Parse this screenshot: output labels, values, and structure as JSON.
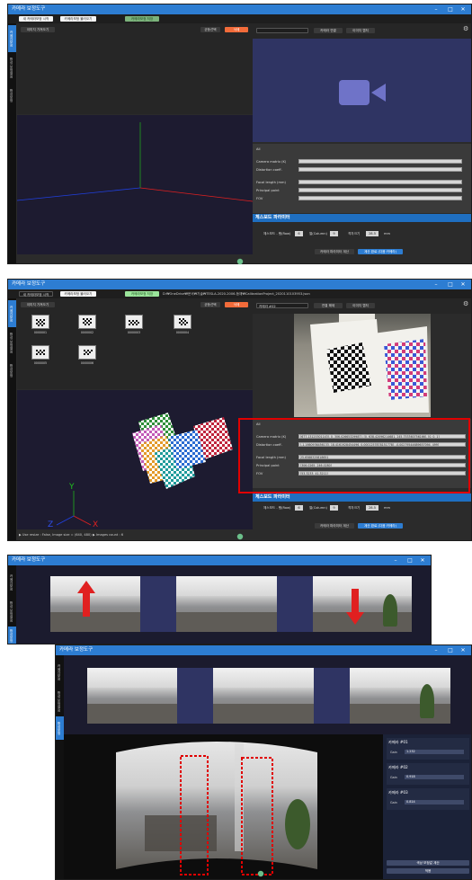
{
  "app": {
    "title": "카메라 보정도구"
  },
  "menu": {
    "new_calibration": "새 카메라보정 시작",
    "load_calibration": "카메라보정 불러오기",
    "camera_calibration": "카메라보정 저장",
    "path": "D:₩OneDrive₩문서₩기술₩TESLA-2020-2006-등재₩CalibrationProject_2020110103953.json"
  },
  "sidetabs": {
    "cam_calib": "카메라보정",
    "chess_hash": "합성 보정설정",
    "merge": "합성보정"
  },
  "left_panel": {
    "load_images_btn": "이미지 가져오기",
    "even_select_btn": "균등선택",
    "delete_btn": "삭제"
  },
  "right_panel": {
    "camera_select_placeholder": "카메라 #02",
    "connect_btn": "카메라 연결",
    "disconnect_btn": "연결 해제",
    "capture_btn": "이미지 캡처"
  },
  "params": {
    "all_label": "All",
    "camera_matrix_label": "Camera matrix (K)",
    "distortion_label": "Distortion coeff.",
    "focal_label": "Focal length (mm)",
    "principal_label": "Principal point",
    "fov_label": "FOV",
    "camera_matrix_value": "[677.13125301143], 0, 306.02665329987], [0, 638.42096214681, 245.753360756166], [0, 0, 1]",
    "distortion_value": "[-1.1660936456133, 18.4161928454496, 0.0001257878151778], -0.00279544689657094, 499]",
    "focal_value": "25.6588325818651",
    "principal_value": "[306.0265, 246.0280]",
    "fov_value": "[53.3233, 41.3211]"
  },
  "chessboard": {
    "header": "체스보드 파라미터",
    "rows_label": "체스보드 - 행(Row)",
    "rows_value": "6",
    "cols_label": "열(Column)",
    "cols_value": "9",
    "size_label": "격자크기",
    "size_value": "28.5",
    "size_unit": "mm",
    "compute_btn": "카메라 파라미터 계산",
    "done_btn": "계산 완료 (다음 카메라)"
  },
  "thumbnails": [
    {
      "caption": "0000001"
    },
    {
      "caption": "0000002"
    },
    {
      "caption": "0000003"
    },
    {
      "caption": "0000004"
    },
    {
      "caption": "0000005"
    },
    {
      "caption": "0000006"
    }
  ],
  "status": {
    "use_resize": "▶ Use resize : False, Image size = (640, 480)",
    "images_count": "▶ Images count : 6"
  },
  "gains": {
    "cams": [
      {
        "title": "카메라 #01",
        "gain_label": "Gain",
        "gain_value": "1.232"
      },
      {
        "title": "카메라 #02",
        "gain_label": "Gain",
        "gain_value": "0.918"
      },
      {
        "title": "카메라 #03",
        "gain_label": "Gain",
        "gain_value": "0.814"
      }
    ],
    "compute_btn": "색상 보정값 계산",
    "apply_btn": "적용"
  },
  "colors": {
    "titlebar": "#2d7dd2",
    "accent_orange": "#f26b3a",
    "highlight_red": "#e00000",
    "navy": "#2f3463",
    "x_axis": "#e02020",
    "y_axis": "#20a020",
    "z_axis": "#2040e0"
  }
}
